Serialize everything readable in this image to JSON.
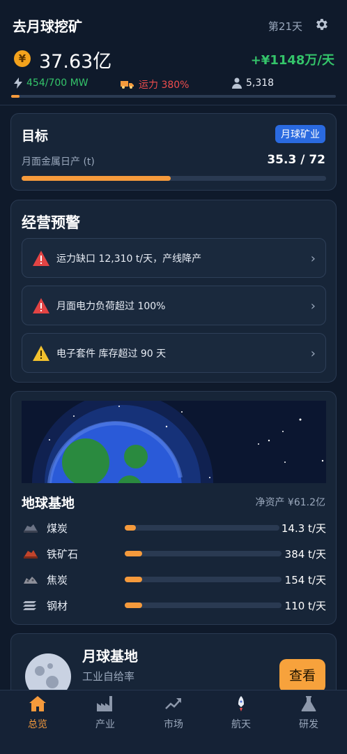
{
  "header": {
    "title": "去月球挖矿",
    "day": "第21天",
    "coin_symbol": "¥",
    "balance": "37.63亿",
    "income": "+¥1148万/天",
    "power": "454/700 MW",
    "transport": "运力 380%",
    "population": "5,318",
    "progress_fraction": 0.025
  },
  "goal": {
    "title": "目标",
    "badge": "月球矿业",
    "label": "月面金属日产 (t)",
    "value": "35.3 / 72",
    "progress": 0.49
  },
  "warnings": {
    "title": "经营预警",
    "items": [
      {
        "text": "运力缺口 12,310 t/天，产线降产",
        "level": "danger",
        "icon": "red-warning-icon"
      },
      {
        "text": "月面电力负荷超过 100%",
        "level": "danger",
        "icon": "red-warning-icon"
      },
      {
        "text": "电子套件 库存超过 90 天",
        "level": "caution",
        "icon": "yellow-warning-icon"
      }
    ],
    "chevron": "›"
  },
  "earth": {
    "title": "地球基地",
    "net_assets": "净资产 ¥61.2亿",
    "resources": [
      {
        "name": "煤炭",
        "value": "14.3 t/天",
        "level": 0.07,
        "icon": "coal-icon"
      },
      {
        "name": "铁矿石",
        "value": "384 t/天",
        "level": 0.11,
        "icon": "iron-ore-icon"
      },
      {
        "name": "焦炭",
        "value": "154 t/天",
        "level": 0.11,
        "icon": "coke-icon"
      },
      {
        "name": "钢材",
        "value": "110 t/天",
        "level": 0.11,
        "icon": "steel-icon"
      }
    ]
  },
  "moon": {
    "title": "月球基地",
    "subtitle": "工业自给率",
    "button": "查看"
  },
  "tabs": [
    {
      "label": "总览",
      "icon": "home-icon",
      "active": true
    },
    {
      "label": "产业",
      "icon": "factory-icon",
      "active": false
    },
    {
      "label": "市场",
      "icon": "trend-icon",
      "active": false
    },
    {
      "label": "航天",
      "icon": "rocket-icon",
      "active": false
    },
    {
      "label": "研发",
      "icon": "flask-icon",
      "active": false
    }
  ],
  "colors": {
    "background": "#0f1a2b",
    "card": "#172538",
    "accent": "#f59a3c",
    "positive": "#34c46a",
    "negative": "#ef4d4d",
    "badge": "#2a6ae0"
  }
}
